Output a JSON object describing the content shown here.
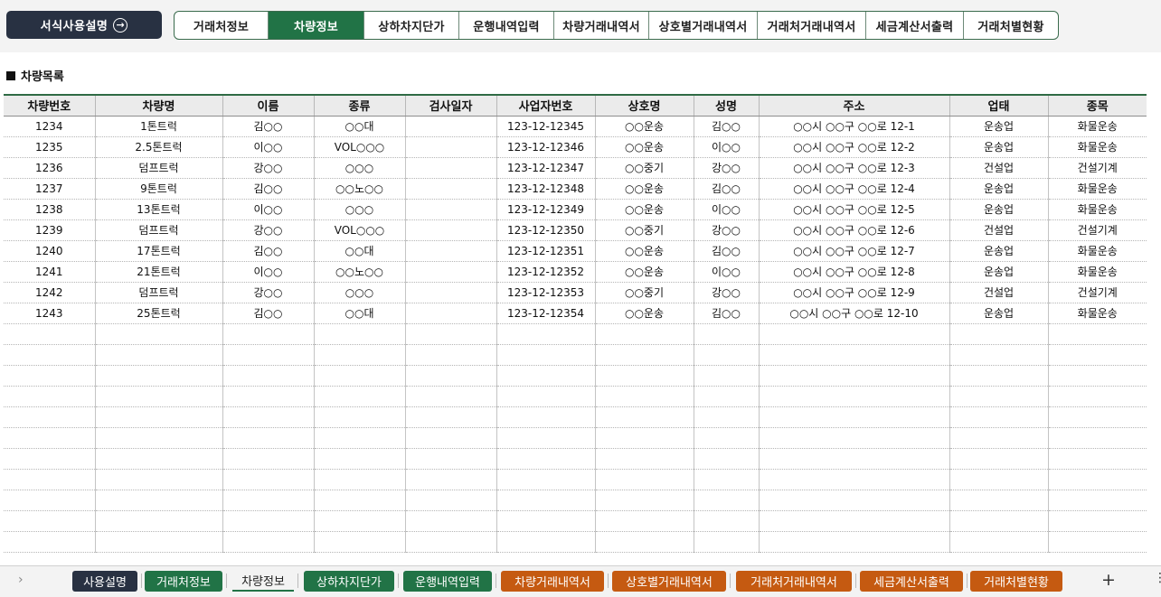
{
  "top": {
    "guide_label": "서식사용설명",
    "guide_icon": "arrow-right-circle-icon",
    "nav": [
      {
        "label": "거래처정보",
        "active": false
      },
      {
        "label": "차량정보",
        "active": true
      },
      {
        "label": "상하차지단가",
        "active": false
      },
      {
        "label": "운행내역입력",
        "active": false
      },
      {
        "label": "차량거래내역서",
        "active": false
      },
      {
        "label": "상호별거래내역서",
        "active": false
      },
      {
        "label": "거래처거래내역서",
        "active": false
      },
      {
        "label": "세금계산서출력",
        "active": false
      },
      {
        "label": "거래처별현황",
        "active": false
      }
    ]
  },
  "section": {
    "marker": "■",
    "title": "차량목록"
  },
  "table": {
    "columns": [
      "차량번호",
      "차량명",
      "이름",
      "종류",
      "검사일자",
      "사업자번호",
      "상호명",
      "성명",
      "주소",
      "업태",
      "종목"
    ],
    "rows": [
      [
        "1234",
        "1톤트럭",
        "김○○",
        "○○대",
        "",
        "123-12-12345",
        "○○운송",
        "김○○",
        "○○시 ○○구 ○○로 12-1",
        "운송업",
        "화물운송"
      ],
      [
        "1235",
        "2.5톤트럭",
        "이○○",
        "VOL○○○",
        "",
        "123-12-12346",
        "○○운송",
        "이○○",
        "○○시 ○○구 ○○로 12-2",
        "운송업",
        "화물운송"
      ],
      [
        "1236",
        "덤프트럭",
        "강○○",
        "○○○",
        "",
        "123-12-12347",
        "○○중기",
        "강○○",
        "○○시 ○○구 ○○로 12-3",
        "건설업",
        "건설기계"
      ],
      [
        "1237",
        "9톤트럭",
        "김○○",
        "○○노○○",
        "",
        "123-12-12348",
        "○○운송",
        "김○○",
        "○○시 ○○구 ○○로 12-4",
        "운송업",
        "화물운송"
      ],
      [
        "1238",
        "13톤트럭",
        "이○○",
        "○○○",
        "",
        "123-12-12349",
        "○○운송",
        "이○○",
        "○○시 ○○구 ○○로 12-5",
        "운송업",
        "화물운송"
      ],
      [
        "1239",
        "덤프트럭",
        "강○○",
        "VOL○○○",
        "",
        "123-12-12350",
        "○○중기",
        "강○○",
        "○○시 ○○구 ○○로 12-6",
        "건설업",
        "건설기계"
      ],
      [
        "1240",
        "17톤트럭",
        "김○○",
        "○○대",
        "",
        "123-12-12351",
        "○○운송",
        "김○○",
        "○○시 ○○구 ○○로 12-7",
        "운송업",
        "화물운송"
      ],
      [
        "1241",
        "21톤트럭",
        "이○○",
        "○○노○○",
        "",
        "123-12-12352",
        "○○운송",
        "이○○",
        "○○시 ○○구 ○○로 12-8",
        "운송업",
        "화물운송"
      ],
      [
        "1242",
        "덤프트럭",
        "강○○",
        "○○○",
        "",
        "123-12-12353",
        "○○중기",
        "강○○",
        "○○시 ○○구 ○○로 12-9",
        "건설업",
        "건설기계"
      ],
      [
        "1243",
        "25톤트럭",
        "김○○",
        "○○대",
        "",
        "123-12-12354",
        "○○운송",
        "김○○",
        "○○시 ○○구 ○○로 12-10",
        "운송업",
        "화물운송"
      ]
    ],
    "empty_rows": 11
  },
  "sheets": {
    "scroll_left_icon": "chevron-right-icon",
    "add_icon": "plus-icon",
    "more_icon": "vertical-dots-icon",
    "tabs": [
      {
        "label": "사용설명",
        "color": "#283142",
        "current": false
      },
      {
        "label": "거래처정보",
        "color": "#217346",
        "current": false
      },
      {
        "label": "차량정보",
        "color": "#217346",
        "current": true
      },
      {
        "label": "상하차지단가",
        "color": "#217346",
        "current": false
      },
      {
        "label": "운행내역입력",
        "color": "#217346",
        "current": false
      },
      {
        "label": "차량거래내역서",
        "color": "#c55a11",
        "current": false
      },
      {
        "label": "상호별거래내역서",
        "color": "#c55a11",
        "current": false
      },
      {
        "label": "거래처거래내역서",
        "color": "#c55a11",
        "current": false
      },
      {
        "label": "세금계산서출력",
        "color": "#c55a11",
        "current": false
      },
      {
        "label": "거래처별현황",
        "color": "#c55a11",
        "current": false
      }
    ]
  }
}
